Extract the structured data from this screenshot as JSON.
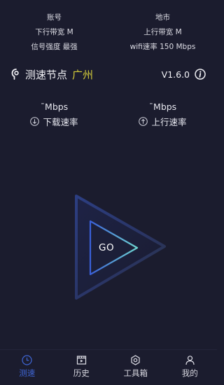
{
  "account_info": {
    "account_label": "账号",
    "location_label": "地市",
    "download_bw": "下行带宽 M",
    "upload_bw": "上行带宽 M",
    "signal": "信号强度 最强",
    "wifi_rate": "wifi速率 150 Mbps"
  },
  "node": {
    "label": "测速节点",
    "city": "广州",
    "version": "V1.6.0"
  },
  "speeds": {
    "download": {
      "value": "¯Mbps",
      "label": "下载速率"
    },
    "upload": {
      "value": "¯Mbps",
      "label": "上行速率"
    }
  },
  "go_button": {
    "label": "GO"
  },
  "nav": [
    {
      "label": "测速",
      "icon": "clock-icon",
      "active": true
    },
    {
      "label": "历史",
      "icon": "film-icon",
      "active": false
    },
    {
      "label": "工具箱",
      "icon": "gear-icon",
      "active": false
    },
    {
      "label": "我的",
      "icon": "user-icon",
      "active": false
    }
  ],
  "colors": {
    "background": "#1b1c2e",
    "accent": "#3f66d6",
    "city": "#d4cc3a",
    "go_gradient_start": "#3a5fd8",
    "go_gradient_end": "#6fd6d2"
  }
}
